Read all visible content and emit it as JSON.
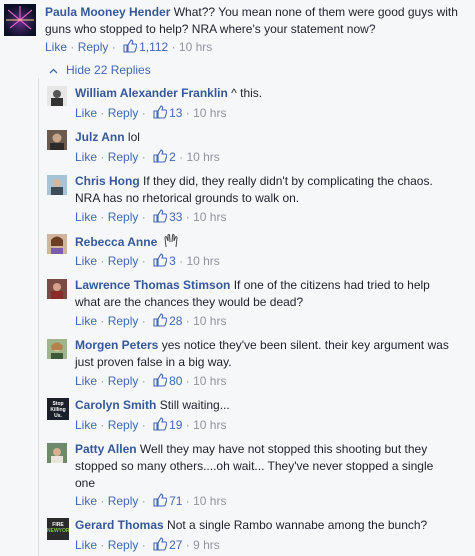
{
  "main_comment": {
    "author": "Paula Mooney Hender",
    "text_line1": "What?? You mean none of them were good guys with",
    "text_line2": "guns who stopped to help? NRA where's your statement now?",
    "like_label": "Like",
    "reply_label": "Reply",
    "likes": "1,112",
    "time": "10 hrs"
  },
  "hide_replies_label": "Hide 22 Replies",
  "replies": [
    {
      "author": "William Alexander Franklin",
      "l1": "^ this.",
      "l2": "",
      "likes": "13",
      "time": "10 hrs"
    },
    {
      "author": "Julz Ann",
      "l1": "lol",
      "l2": "",
      "likes": "2",
      "time": "10 hrs"
    },
    {
      "author": "Chris Hong",
      "l1": "If they did, they really didn't by complicating the chaos.",
      "l2": "NRA has no rhetorical grounds to walk on.",
      "likes": "33",
      "time": "10 hrs"
    },
    {
      "author": "Rebecca Anne",
      "l1": "",
      "l2": "",
      "likes": "3",
      "time": "10 hrs"
    },
    {
      "author": "Lawrence Thomas Stimson",
      "l1": "If one of the citizens had tried to help",
      "l2": "what are the chances they would be dead?",
      "likes": "28",
      "time": "10 hrs"
    },
    {
      "author": "Morgen Peters",
      "l1": "yes notice they've been silent. their key argument was",
      "l2": "just proven false in a big way.",
      "likes": "80",
      "time": "10 hrs"
    },
    {
      "author": "Carolyn Smith",
      "l1": "Still waiting...",
      "l2": "",
      "likes": "19",
      "time": "10 hrs"
    },
    {
      "author": "Patty Allen",
      "l1": "Well they may have not stopped this shooting but they",
      "l2": "stopped so many others....oh wait... They've never stopped a single",
      "l3": "one",
      "likes": "71",
      "time": "10 hrs"
    },
    {
      "author": "Gerard Thomas",
      "l1": "Not a single Rambo wannabe among the bunch?",
      "l2": "",
      "likes": "27",
      "time": "9 hrs"
    }
  ],
  "common": {
    "like_label": "Like",
    "reply_label": "Reply",
    "dot": "·"
  },
  "avatar_texts": {
    "carolyn": "Stop Killing Us.",
    "gerard_1": "FIRE",
    "gerard_2": "NEWYORK"
  }
}
